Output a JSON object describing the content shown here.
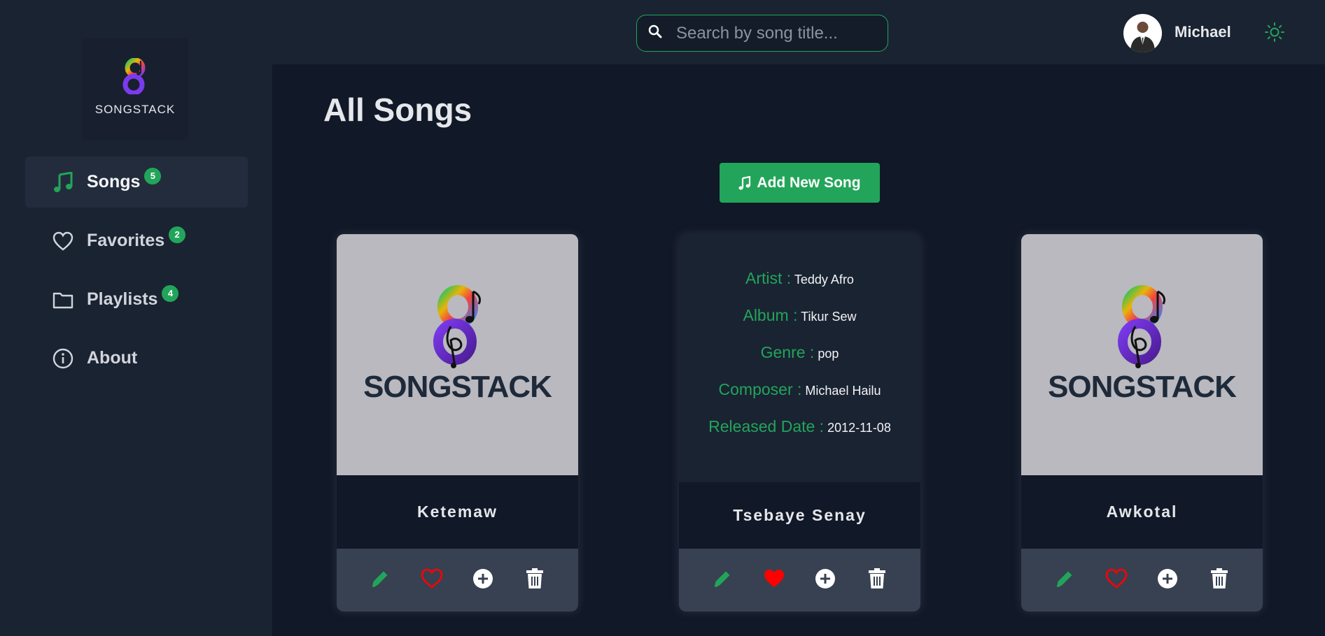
{
  "app": {
    "logo_text": "SONGSTACK"
  },
  "sidebar": {
    "items": [
      {
        "label": "Songs",
        "badge": "5",
        "icon": "music-note-icon",
        "active": true
      },
      {
        "label": "Favorites",
        "badge": "2",
        "icon": "heart-icon"
      },
      {
        "label": "Playlists",
        "badge": "4",
        "icon": "folder-icon"
      },
      {
        "label": "About",
        "badge": "",
        "icon": "info-icon"
      }
    ]
  },
  "header": {
    "search_placeholder": "Search by song title...",
    "user_name": "Michael",
    "theme_icon": "sun-icon"
  },
  "main": {
    "title": "All Songs",
    "add_button_label": "Add New Song",
    "songs": [
      {
        "title": "Ketemaw",
        "image_text": "SONGSTACK",
        "favorite": false
      },
      {
        "title": "Tsebaye Senay",
        "favorite": true,
        "details": [
          {
            "key": "Artist :",
            "value": "Teddy Afro"
          },
          {
            "key": "Album :",
            "value": "Tikur Sew"
          },
          {
            "key": "Genre :",
            "value": "pop"
          },
          {
            "key": "Composer :",
            "value": "Michael Hailu"
          },
          {
            "key": "Released Date :",
            "value": "2012-11-08"
          }
        ]
      },
      {
        "title": "Awkotal",
        "image_text": "SONGSTACK",
        "favorite": false
      }
    ]
  },
  "colors": {
    "accent": "#22a55a",
    "favorite": "#ff0000",
    "background": "#111827",
    "sidebar": "#1a2332",
    "card_image": "#b9b9bf",
    "actions_bar": "#374151"
  }
}
